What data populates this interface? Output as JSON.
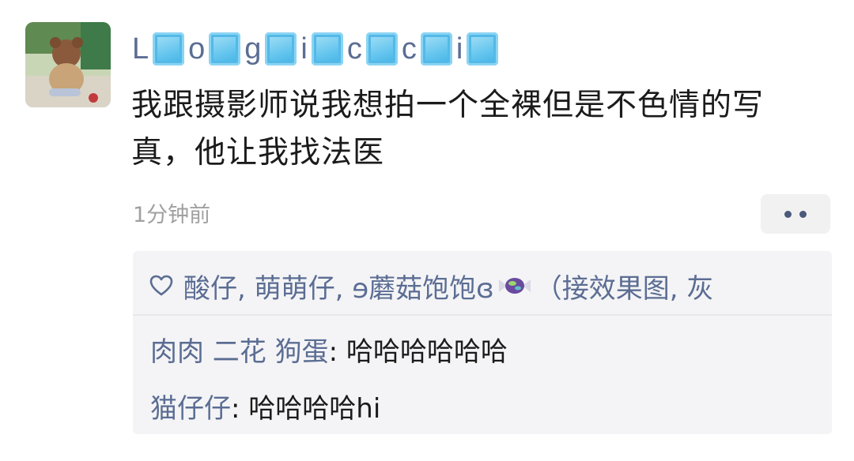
{
  "post": {
    "author_chars": [
      "L",
      "o",
      "g",
      "i",
      "c",
      "c",
      "i"
    ],
    "content": "我跟摄影师说我想拍一个全裸但是不色情的写真，他让我找法医",
    "time": "1分钟前"
  },
  "likes": {
    "text_before": "酸仔, 萌萌仔, ɘ蘑菇饱饱ɞ",
    "text_after": "（接效果图, 灰"
  },
  "comments": [
    {
      "author": "肉肉 二花 狗蛋",
      "sep": ": ",
      "text": "哈哈哈哈哈哈"
    },
    {
      "author": "猫仔仔",
      "sep": ": ",
      "text": "哈哈哈哈hi"
    }
  ],
  "icons": {
    "more": "more-dots-icon",
    "like": "heart-icon",
    "tile": "blue-tile-emoji",
    "candy": "candy-emoji"
  },
  "colors": {
    "name": "#5b6d93",
    "text": "#1b1b1b",
    "time": "#a0a0a0",
    "panel": "#f4f4f6"
  }
}
